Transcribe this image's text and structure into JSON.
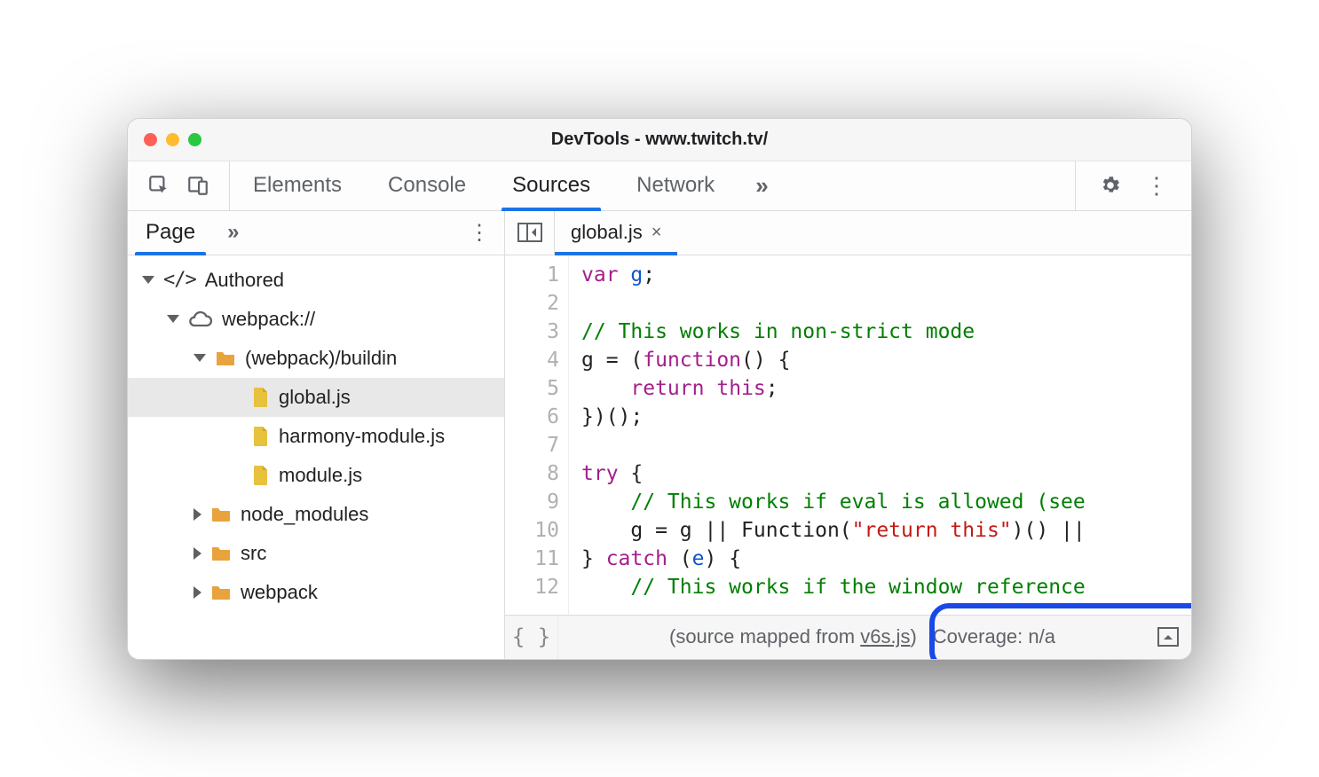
{
  "window": {
    "title": "DevTools - www.twitch.tv/"
  },
  "main_tabs": {
    "items": [
      "Elements",
      "Console",
      "Sources",
      "Network"
    ],
    "active_index": 2
  },
  "sidebar": {
    "tabs": {
      "active": "Page"
    },
    "tree": {
      "root": "Authored",
      "origin": "webpack://",
      "buildin_folder": "(webpack)/buildin",
      "files": [
        "global.js",
        "harmony-module.js",
        "module.js"
      ],
      "closed_folders": [
        "node_modules",
        "src",
        "webpack"
      ],
      "selected_file": "global.js"
    }
  },
  "editor": {
    "open_tab": "global.js",
    "line_count": 12,
    "code": {
      "l1_kw": "var",
      "l1_var": "g",
      "l1_end": ";",
      "l3_cm": "// This works in non-strict mode",
      "l4_a": "g = (",
      "l4_kw": "function",
      "l4_b": "() {",
      "l5_pad": "    ",
      "l5_kw": "return",
      "l5_sp": " ",
      "l5_kw2": "this",
      "l5_end": ";",
      "l6": "})();",
      "l8_kw": "try",
      "l8_b": " {",
      "l9_pad": "    ",
      "l9_cm": "// This works if eval is allowed (see",
      "l10_pad": "    ",
      "l10_a": "g = g || Function(",
      "l10_str": "\"return this\"",
      "l10_b": ")() ||",
      "l11_a": "} ",
      "l11_kw": "catch",
      "l11_b": " (",
      "l11_var": "e",
      "l11_c": ") {",
      "l12_pad": "    ",
      "l12_cm": "// This works if the window reference"
    }
  },
  "statusbar": {
    "mapped_prefix": "(source mapped from ",
    "mapped_link": "v6s.js",
    "mapped_suffix": ")",
    "coverage": "Coverage: n/a"
  },
  "glyphs": {
    "overflow": "»",
    "kebab": "⋮",
    "close": "×",
    "braces": "{ }"
  }
}
